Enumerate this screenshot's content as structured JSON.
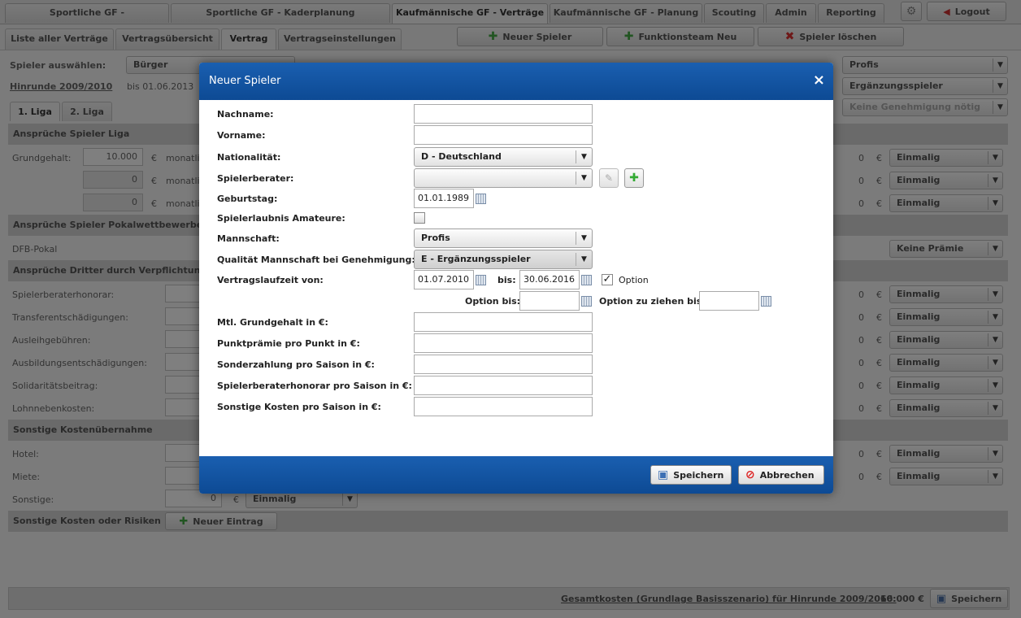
{
  "top_tabs": [
    "Sportliche GF - Spielfeldplanung",
    "Sportliche GF - Kaderplanung Listenansicht",
    "Kaufmännische GF - Verträge",
    "Kaufmännische GF - Planung",
    "Scouting",
    "Admin",
    "Reporting"
  ],
  "logout_label": "Logout",
  "sub_tabs": [
    "Liste aller Verträge",
    "Vertragsübersicht",
    "Vertrag",
    "Vertragseinstellungen"
  ],
  "toolbar": {
    "new_player": "Neuer Spieler",
    "new_staff": "Funktionsteam Neu",
    "delete_player": "Spieler löschen"
  },
  "player_select_label": "Spieler auswählen:",
  "player_value": "Bürger",
  "period_link": "Hinrunde 2009/2010",
  "period_until": "bis 01.06.2013",
  "right_selects": [
    "Profis",
    "Ergänzungsspieler",
    "Keine Genehmigung nötig"
  ],
  "liga_tabs": [
    "1. Liga",
    "2. Liga"
  ],
  "sections": {
    "liga": "Ansprüche Spieler Liga",
    "pokal": "Ansprüche Spieler Pokalwettbewerbe",
    "dritte": "Ansprüche Dritter durch Verpflichtung/Transfer",
    "kosten": "Sonstige Kostenübernahme",
    "risiken": "Sonstige Kosten oder Risiken"
  },
  "grundgehalt": {
    "label": "Grundgehalt:",
    "value": "10.000",
    "currency": "€",
    "unit": "monatlich"
  },
  "dfb_pokal": "DFB-Pokal",
  "keine_praemie": "Keine Prämie",
  "dritte_rows": [
    "Spielerberaterhonorar:",
    "Transferentschädigungen:",
    "Ausleihgebühren:",
    "Ausbildungsentschädigungen:",
    "Solidaritätsbeitrag:",
    "Lohnnebenkosten:"
  ],
  "kosten_rows": [
    "Hotel:",
    "Miete:",
    "Sonstige:"
  ],
  "zero": "0",
  "einmalig": "Einmalig",
  "neuer_eintrag": "Neuer Eintrag",
  "footer": {
    "total_label": "Gesamtkosten (Grundlage Basisszenario) für Hinrunde 2009/2010:",
    "total_value": "66.000 €",
    "save": "Speichern"
  },
  "dialog": {
    "title": "Neuer Spieler",
    "close": "×",
    "nachname": "Nachname:",
    "vorname": "Vorname:",
    "nationalitaet": "Nationalität:",
    "nationalitaet_value": "D - Deutschland",
    "spielerberater": "Spielerberater:",
    "geburtstag": "Geburtstag:",
    "geburtstag_value": "01.01.1989",
    "spielerlaubnis": "Spielerlaubnis Amateure:",
    "mannschaft": "Mannschaft:",
    "mannschaft_value": "Profis",
    "qualitaet": "Qualität Mannschaft bei Genehmigung:",
    "qualitaet_value": "E - Ergänzungsspieler",
    "laufzeit": "Vertragslaufzeit von:",
    "laufzeit_von": "01.07.2010",
    "bis": "bis:",
    "laufzeit_bis": "30.06.2016",
    "option": "Option",
    "option_bis": "Option bis:",
    "option_ziehen": "Option zu ziehen bis:",
    "grundgehalt": "Mtl. Grundgehalt in €:",
    "punktpraemie": "Punktprämie pro Punkt in €:",
    "sonderzahlung": "Sonderzahlung pro Saison in €:",
    "beraterhonorar": "Spielerberaterhonorar pro Saison in €:",
    "sonstige": "Sonstige Kosten pro Saison in €:",
    "save": "Speichern",
    "cancel": "Abbrechen"
  }
}
